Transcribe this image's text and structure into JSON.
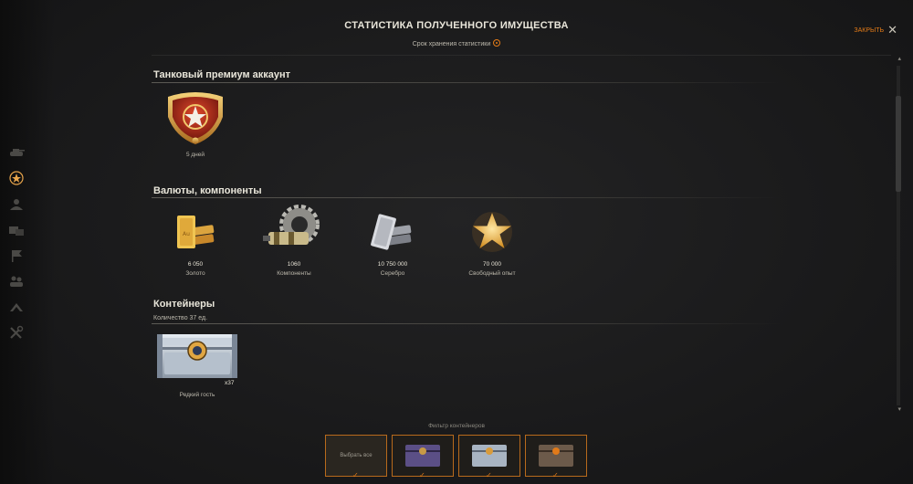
{
  "header": {
    "title": "СТАТИСТИКА ПОЛУЧЕННОГО ИМУЩЕСТВА",
    "subtitle": "Срок хранения статистики",
    "close_label": "ЗАКРЫТЬ"
  },
  "sections": {
    "premium": {
      "title": "Танковый премиум аккаунт",
      "item_label": "5 дней"
    },
    "currencies": {
      "title": "Валюты, компоненты",
      "items": [
        {
          "value": "6 050",
          "label": "Золото"
        },
        {
          "value": "1060",
          "label": "Компоненты"
        },
        {
          "value": "10 750 000",
          "label": "Серебро"
        },
        {
          "value": "70 000",
          "label": "Свободный опыт"
        }
      ]
    },
    "containers": {
      "title": "Контейнеры",
      "count_text": "Количество 37 ед.",
      "item": {
        "label": "Редкий гость",
        "multiplier": "x37"
      }
    }
  },
  "filter": {
    "label": "Фильтр контейнеров",
    "select_all": "Выбрать все"
  },
  "colors": {
    "accent": "#e37b18",
    "background": "#1b1b1c",
    "text": "#d6d2c4"
  },
  "sidebar_icons": [
    "tank-icon",
    "star-icon",
    "crew-icon",
    "vehicles-icon",
    "flag-icon",
    "group-icon",
    "rank-icon",
    "tools-icon"
  ]
}
